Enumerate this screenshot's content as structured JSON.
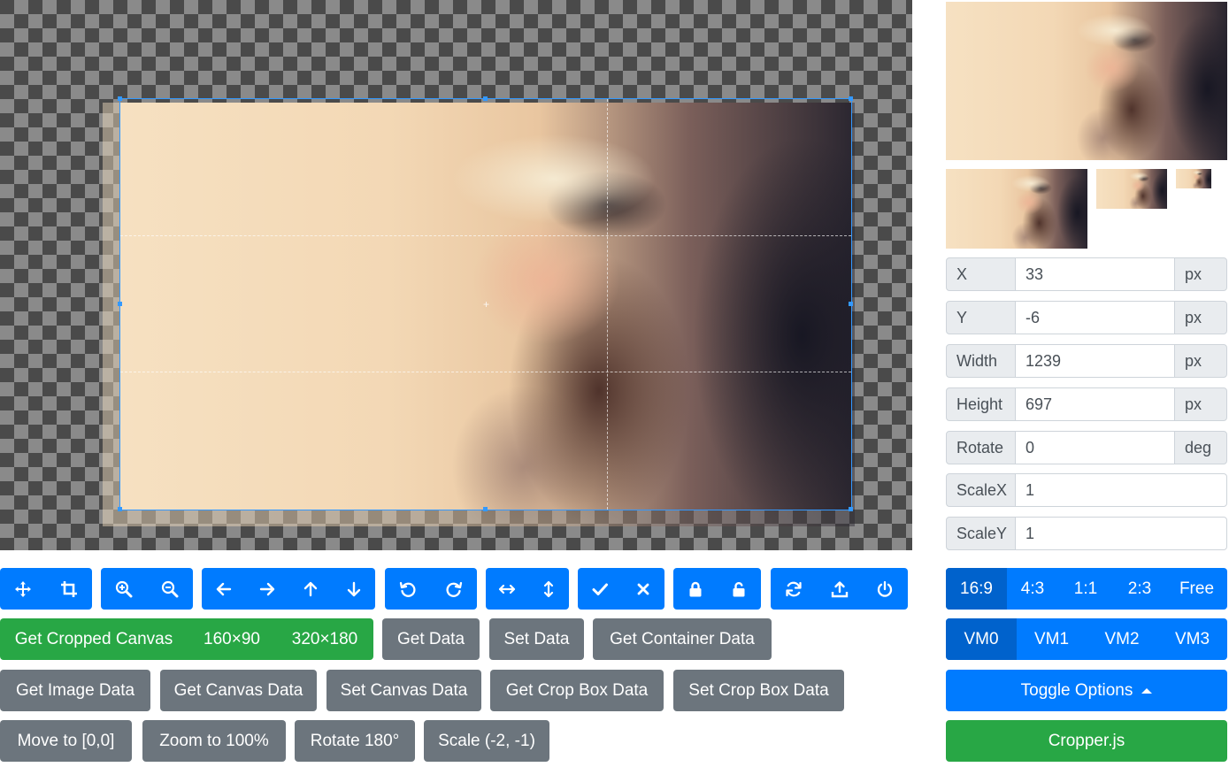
{
  "toolbar_groups": [
    {
      "name": "mode",
      "icons": [
        "move-icon",
        "crop-icon"
      ]
    },
    {
      "name": "zoom",
      "icons": [
        "zoom-in-icon",
        "zoom-out-icon"
      ]
    },
    {
      "name": "move",
      "icons": [
        "arrow-left-icon",
        "arrow-right-icon",
        "arrow-up-icon",
        "arrow-down-icon"
      ]
    },
    {
      "name": "rotate",
      "icons": [
        "rotate-left-icon",
        "rotate-right-icon"
      ]
    },
    {
      "name": "flip",
      "icons": [
        "flip-horizontal-icon",
        "flip-vertical-icon"
      ]
    },
    {
      "name": "crop-actions",
      "icons": [
        "check-icon",
        "close-icon"
      ]
    },
    {
      "name": "lock",
      "icons": [
        "lock-icon",
        "unlock-icon"
      ]
    },
    {
      "name": "misc",
      "icons": [
        "refresh-icon",
        "upload-icon",
        "power-icon"
      ]
    }
  ],
  "buttons": {
    "cropped_canvas": {
      "label": "Get Cropped Canvas",
      "size1": "160×90",
      "size2": "320×180"
    },
    "get_data": "Get Data",
    "set_data": "Set Data",
    "get_container_data": "Get Container Data",
    "get_image_data": "Get Image Data",
    "get_canvas_data": "Get Canvas Data",
    "set_canvas_data": "Set Canvas Data",
    "get_crop_box_data": "Get Crop Box Data",
    "set_crop_box_data": "Set Crop Box Data",
    "move_to": "Move to [0,0]",
    "zoom_to": "Zoom to 100%",
    "rotate_180": "Rotate 180°",
    "scale": "Scale (-2, -1)"
  },
  "data_fields": {
    "x": {
      "label": "X",
      "value": "33",
      "unit": "px"
    },
    "y": {
      "label": "Y",
      "value": "-6",
      "unit": "px"
    },
    "width": {
      "label": "Width",
      "value": "1239",
      "unit": "px"
    },
    "height": {
      "label": "Height",
      "value": "697",
      "unit": "px"
    },
    "rotate": {
      "label": "Rotate",
      "value": "0",
      "unit": "deg"
    },
    "scale_x": {
      "label": "ScaleX",
      "value": "1"
    },
    "scale_y": {
      "label": "ScaleY",
      "value": "1"
    }
  },
  "aspect_ratio": {
    "options": [
      "16:9",
      "4:3",
      "1:1",
      "2:3",
      "Free"
    ],
    "selected": "16:9"
  },
  "view_mode": {
    "options": [
      "VM0",
      "VM1",
      "VM2",
      "VM3"
    ],
    "selected": "VM0"
  },
  "toggle_options": {
    "label": "Toggle Options"
  },
  "brand_button": "Cropper.js",
  "colors": {
    "primary": "#007bff",
    "primary_active": "#0062cc",
    "secondary": "#6c757d",
    "success": "#28a745",
    "crop_outline": "#3399ff"
  }
}
